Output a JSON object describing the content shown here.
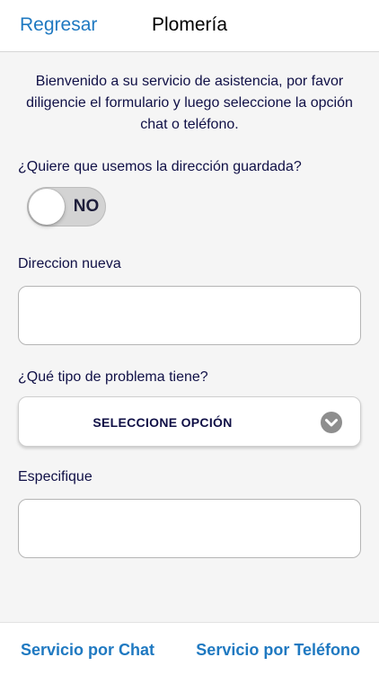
{
  "navbar": {
    "back_label": "Regresar",
    "title": "Plomería"
  },
  "intro": {
    "text": "Bienvenido a su servicio de asistencia, por favor diligencie el formulario y luego seleccione la opción chat o teléfono."
  },
  "form": {
    "saved_address_question": "¿Quiere que usemos la dirección guardada?",
    "saved_address_toggle": {
      "state_label": "NO"
    },
    "new_address_label": "Direccion nueva",
    "new_address_value": "",
    "problem_type_label": "¿Qué tipo de problema tiene?",
    "problem_type_selected": "SELECCIONE OPCIÓN",
    "specify_label": "Especifique",
    "specify_value": ""
  },
  "bottom_bar": {
    "chat_label": "Servicio por Chat",
    "phone_label": "Servicio por Teléfono"
  },
  "icons": {
    "select_chevron": "chevron-down-icon"
  },
  "colors": {
    "accent": "#1f79c1",
    "text": "#101046",
    "background": "#f5f5f5",
    "toggle_off": "#d3d3d3",
    "chevron": "#8e8e8e"
  }
}
